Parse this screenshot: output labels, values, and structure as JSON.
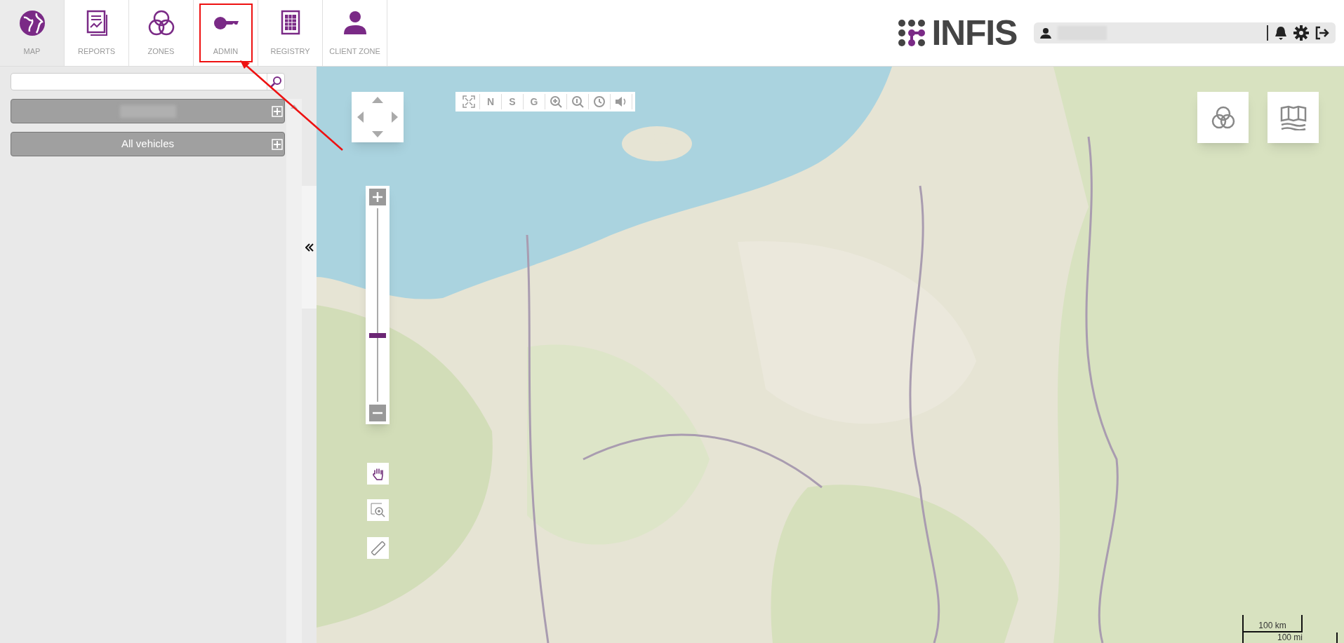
{
  "nav_tabs": [
    {
      "label": "MAP",
      "selected": true,
      "annotated": false
    },
    {
      "label": "REPORTS",
      "selected": false,
      "annotated": false
    },
    {
      "label": "ZONES",
      "selected": false,
      "annotated": false
    },
    {
      "label": "ADMIN",
      "selected": false,
      "annotated": true
    },
    {
      "label": "REGISTRY",
      "selected": false,
      "annotated": false
    },
    {
      "label": "CLIENT ZONE",
      "selected": false,
      "annotated": false
    }
  ],
  "logo": {
    "text": "INFIS"
  },
  "sidebar": {
    "groups": [
      {
        "kind": "hidden"
      },
      {
        "kind": "text",
        "label": "All vehicles"
      }
    ]
  },
  "map": {
    "toolbar": [
      {
        "kind": "icon"
      },
      {
        "kind": "text",
        "label": "N"
      },
      {
        "kind": "text",
        "label": "S"
      },
      {
        "kind": "text",
        "label": "G"
      },
      {
        "kind": "icon"
      },
      {
        "kind": "icon"
      },
      {
        "kind": "icon"
      },
      {
        "kind": "icon"
      }
    ],
    "zoom_slider": {
      "level": 0.34
    },
    "scale": {
      "metric": "100 km",
      "imperial": "100 mi"
    }
  }
}
